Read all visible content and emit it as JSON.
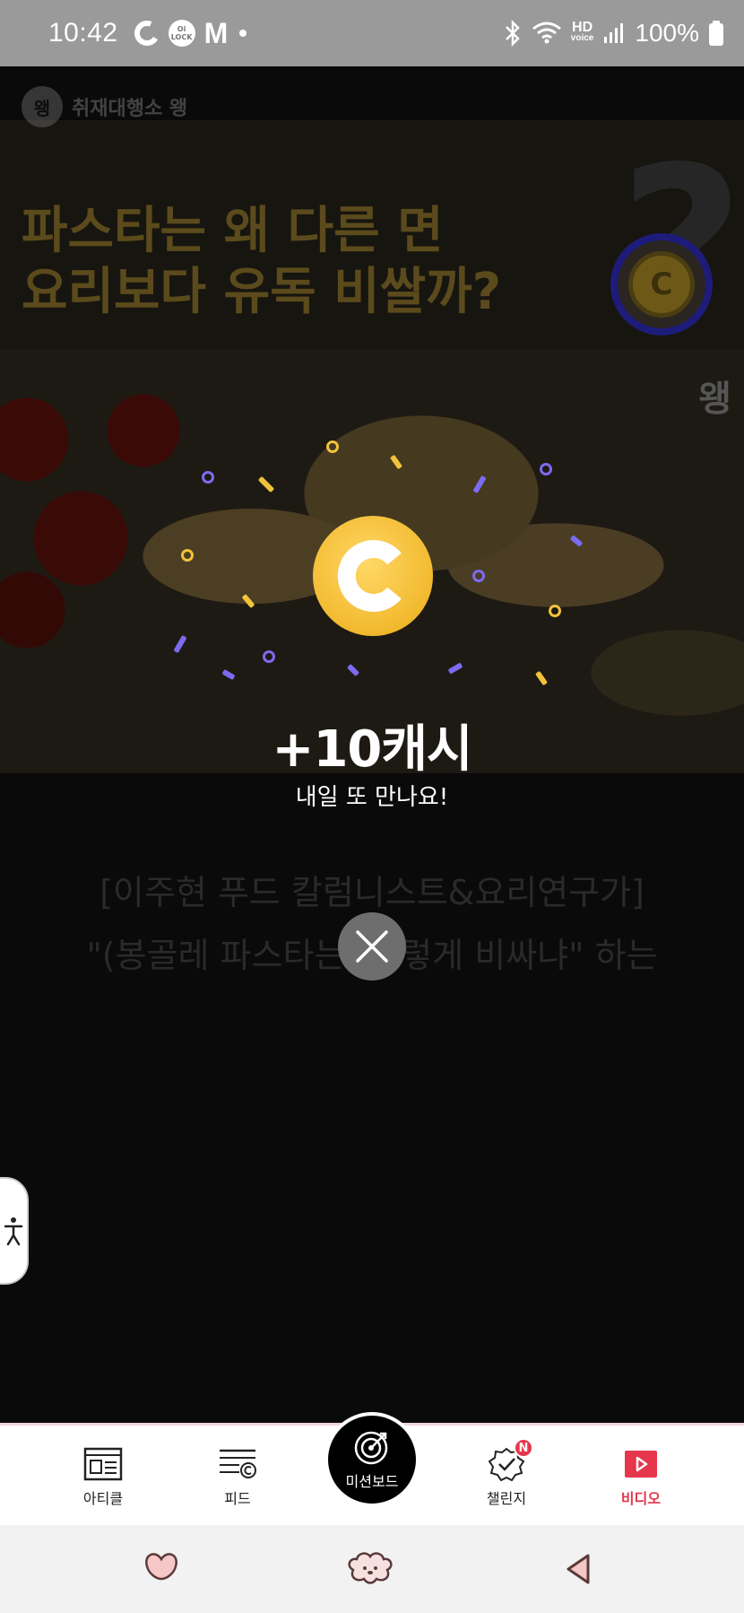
{
  "status_bar": {
    "time": "10:42",
    "left_icons": [
      "c-app-icon",
      "oilock-icon",
      "m-app-icon",
      "dot-icon"
    ],
    "oilock_label": "Oi LOCK",
    "m_label": "M",
    "right_icons": [
      "bluetooth-icon",
      "wifi-icon",
      "hd-voice-icon",
      "signal-icon",
      "battery-icon"
    ],
    "hd_label": "HD",
    "voice_label": "voice",
    "battery": "100%"
  },
  "article": {
    "channel_logo_text": "왱",
    "channel_name": "취재대행소 왱",
    "thumbnail_title_line1": "파스타는 왜 다른 면",
    "thumbnail_title_line2": "요리보다 유독 비쌀까?",
    "thumbnail_big_glyph": "?왱",
    "photo_logo_text": "왱",
    "coin_badge_letter": "C",
    "caption_line1": "[이주현 푸드 칼럼니스트&요리연구가]",
    "caption_line2": "\"(봉골레 파스타는) 이렇게 비싸냐\" 하는"
  },
  "reward": {
    "amount": "+10캐시",
    "message": "내일 또 만나요!",
    "close_label": "닫기"
  },
  "bottom_nav": {
    "items": [
      {
        "label": "아티클",
        "icon": "article-icon"
      },
      {
        "label": "피드",
        "icon": "feed-icon"
      },
      {
        "label": "미션보드",
        "icon": "target-icon"
      },
      {
        "label": "챌린지",
        "icon": "challenge-badge-icon",
        "badge": "N"
      },
      {
        "label": "비디오",
        "icon": "video-play-icon",
        "active": true
      }
    ]
  },
  "colors": {
    "accent": "#e5364b",
    "coin_gold": "#f2b92e",
    "confetti_purple": "#7b6bf0",
    "confetti_yellow": "#f2c23c"
  }
}
